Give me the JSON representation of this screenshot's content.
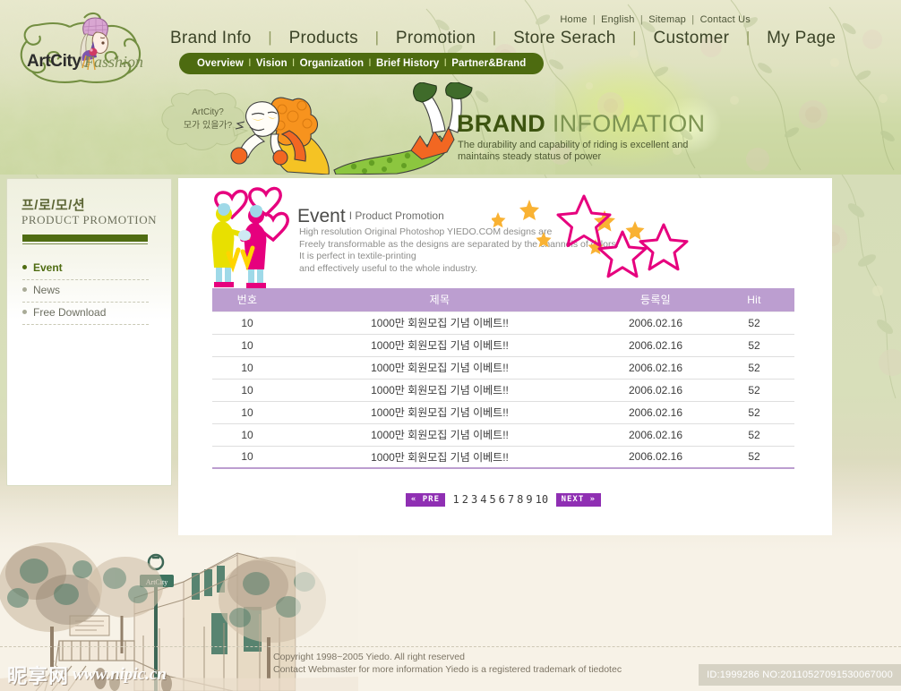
{
  "site": {
    "logo_name": "ArtCity",
    "logo_sub": "Fasshion"
  },
  "util_nav": [
    {
      "label": "Home"
    },
    {
      "label": "English"
    },
    {
      "label": "Sitemap"
    },
    {
      "label": "Contact Us"
    }
  ],
  "main_nav": [
    {
      "label": "Brand Info"
    },
    {
      "label": "Products"
    },
    {
      "label": "Promotion"
    },
    {
      "label": "Store Serach"
    },
    {
      "label": "Customer"
    },
    {
      "label": "My Page"
    }
  ],
  "sub_nav": {
    "items": [
      "Overview",
      "Vision",
      "Organization",
      "Brief History",
      "Partner&Brand"
    ],
    "separator": "I"
  },
  "bubble": {
    "line1": "ArtCity?",
    "line2": "모가 있을가?"
  },
  "banner": {
    "title_bold": "BRAND",
    "title_light": "INFOMATION",
    "sub_line1": "The durability and capability of riding is  excellent and",
    "sub_line2": "maintains steady status of power"
  },
  "sidebar": {
    "title_ko": "프/로/모/션",
    "title_en": "PRODUCT PROMOTION",
    "items": [
      {
        "label": "Event",
        "active": true
      },
      {
        "label": "News",
        "active": false
      },
      {
        "label": "Free Download",
        "active": false
      }
    ]
  },
  "event": {
    "title": "Event",
    "subtitle": "I Product Promotion",
    "desc_lines": [
      "High resolution Original Photoshop YIEDO.COM designs are",
      "Freely transformable as the designs are separated by the channels of colors.",
      "It is perfect in textile-printing",
      "and effectively useful to the whole industry."
    ]
  },
  "table": {
    "headers": [
      "번호",
      "제목",
      "등록일",
      "Hit"
    ],
    "rows": [
      {
        "no": "10",
        "title": "1000만 회원모집 기념 이베트!!",
        "date": "2006.02.16",
        "hit": "52"
      },
      {
        "no": "10",
        "title": "1000만 회원모집 기념 이베트!!",
        "date": "2006.02.16",
        "hit": "52"
      },
      {
        "no": "10",
        "title": "1000만 회원모집 기념 이베트!!",
        "date": "2006.02.16",
        "hit": "52"
      },
      {
        "no": "10",
        "title": "1000만 회원모집 기념 이베트!!",
        "date": "2006.02.16",
        "hit": "52"
      },
      {
        "no": "10",
        "title": "1000만 회원모집 기념 이베트!!",
        "date": "2006.02.16",
        "hit": "52"
      },
      {
        "no": "10",
        "title": "1000만 회원모집 기념 이베트!!",
        "date": "2006.02.16",
        "hit": "52"
      },
      {
        "no": "10",
        "title": "1000만 회원모집 기념 이베트!!",
        "date": "2006.02.16",
        "hit": "52"
      }
    ]
  },
  "pager": {
    "prev_label": "« PRE",
    "next_label": "NEXT »",
    "pages": [
      "1",
      "2",
      "3",
      "4",
      "5",
      "6",
      "7",
      "8",
      "9",
      "10"
    ]
  },
  "footer": {
    "line1": "Copyright 1998~2005 Yiedo. All right reserved",
    "line2": "Contact Webmaster for more information  Yiedo is a registered trademark of tiedotec"
  },
  "watermark": {
    "cn_text": "昵享网",
    "url_text": "www.nipic.cn"
  },
  "id_stamp": {
    "text": "ID:1999286 NO:20110527091530067000"
  },
  "colors": {
    "header_green": "#4d6b10",
    "table_header_purple": "#bc9ed0",
    "pager_purple": "#8f2fb3",
    "brand_dark_green": "#3d5410",
    "sidebar_accent": "#4f6c12"
  }
}
